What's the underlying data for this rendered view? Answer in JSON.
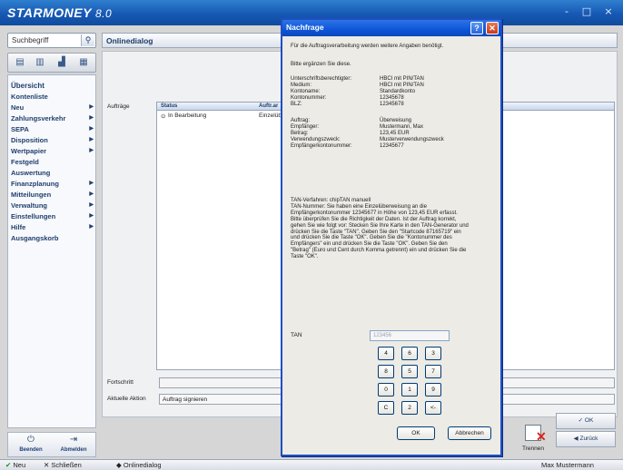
{
  "app": {
    "logo": "STARMONEY",
    "version": "8.0",
    "window_controls": [
      "-",
      "□",
      "×"
    ]
  },
  "search": {
    "placeholder": "Suchbegriff"
  },
  "nav": {
    "items": [
      {
        "label": "Übersicht",
        "arrow": false
      },
      {
        "label": "Kontenliste",
        "arrow": false
      },
      {
        "label": "Neu",
        "arrow": true
      },
      {
        "label": "Zahlungsverkehr",
        "arrow": true
      },
      {
        "label": "SEPA",
        "arrow": true
      },
      {
        "label": "Disposition",
        "arrow": true
      },
      {
        "label": "Wertpapier",
        "arrow": true
      },
      {
        "label": "Festgeld",
        "arrow": false
      },
      {
        "label": "Auswertung",
        "arrow": false
      },
      {
        "label": "Finanzplanung",
        "arrow": true
      },
      {
        "label": "Mitteilungen",
        "arrow": true
      },
      {
        "label": "Verwaltung",
        "arrow": true
      },
      {
        "label": "Einstellungen",
        "arrow": true
      },
      {
        "label": "Hilfe",
        "arrow": true
      },
      {
        "label": "Ausgangskorb",
        "arrow": false
      }
    ],
    "arrow_glyph": "▶"
  },
  "bottom_tools": {
    "beenden": "Beenden",
    "abmelden": "Abmelden"
  },
  "main": {
    "title": "Onlinedialog",
    "auftraege_label": "Aufträge",
    "columns": [
      "Status",
      "Auftr.ar"
    ],
    "row": {
      "status": "In Bearbeitung",
      "auftragsart": "Einzelüb"
    },
    "fortschritt_label": "Fortschritt",
    "progress": 0,
    "aktuelle_aktion_label": "Aktuelle Aktion",
    "aktuelle_aktion": "Auftrag signieren",
    "trennen": "Trennen",
    "ok_label": "OK",
    "zurueck_label": "Zurück"
  },
  "statusbar": {
    "neu": "Neu",
    "schliessen": "Schließen",
    "tab": "Onlinedialog",
    "user": "Max Mustermann"
  },
  "dialog": {
    "title": "Nachfrage",
    "intro": "Für die Auftragsverarbeitung werden weitere Angaben benötigt.",
    "prompt": "Bitte ergänzen Sie diese.",
    "info": [
      {
        "key": "Unterschriftsberechtigter:",
        "value": "HBCI mit PIN/TAN"
      },
      {
        "key": "Medium:",
        "value": "HBCI mit PIN/TAN"
      },
      {
        "key": "Kontoname:",
        "value": "Standardkonto"
      },
      {
        "key": "Kontonummer:",
        "value": "12345678"
      },
      {
        "key": "BLZ:",
        "value": "12345678"
      }
    ],
    "order": [
      {
        "key": "Auftrag:",
        "value": "Überweisung"
      },
      {
        "key": "Empfänger:",
        "value": "Mustermann, Max"
      },
      {
        "key": "Betrag:",
        "value": "123,45 EUR"
      },
      {
        "key": "Verwendungszweck:",
        "value": "Musterverwendungszweck"
      },
      {
        "key": "Empfängerkontonummer:",
        "value": "12345677"
      }
    ],
    "tan_description": "TAN-Verfahren: chipTAN manuell\nTAN-Nummer: Sie haben eine Einzelüberweisung an die Empfängerkontonummer 12345677 in Höhe von 123,45 EUR erfasst. Bitte überprüfen Sie die Richtigkeit der Daten. Ist der Auftrag korrekt, gehen Sie wie folgt vor: Stecken Sie Ihre Karte in den TAN-Generator und drücken Sie die Taste \"TAN\". Geben Sie den \"Startcode 87165719\" ein und drücken Sie die Taste \"OK\". Geben Sie die \"Kontonummer des Empfängers\" ein und drücken Sie die Taste \"OK\". Geben Sie den \"Betrag\" (Euro und Cent durch Komma getrennt) ein und drücken Sie die Taste \"OK\".",
    "tan_label": "TAN",
    "tan_placeholder": "123456",
    "keypad": [
      "4",
      "6",
      "3",
      "8",
      "5",
      "7",
      "0",
      "1",
      "9",
      "C",
      "2",
      "<-"
    ],
    "ok": "OK",
    "cancel": "Abbrechen"
  }
}
